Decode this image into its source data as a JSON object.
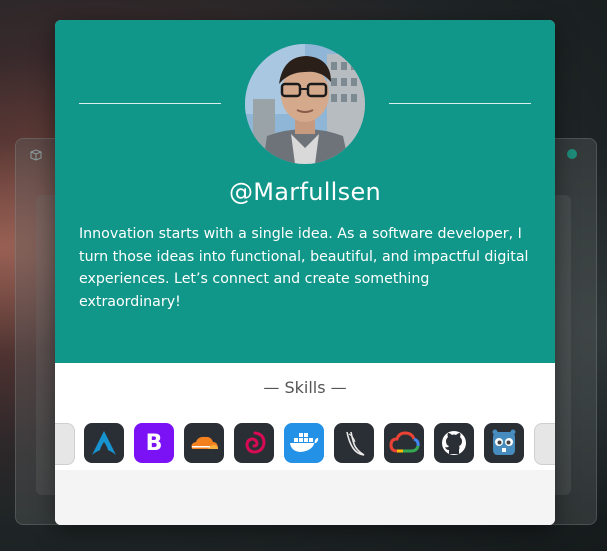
{
  "profile": {
    "username": "@Marfullsen",
    "bio": "Innovation starts with a single idea. As a software developer, I turn those ideas into functional, beautiful, and impactful digital experiences. Let’s connect and create something extraordinary!"
  },
  "skills": {
    "title": "— Skills —",
    "items": [
      {
        "name": "partial-icon-left"
      },
      {
        "name": "arch-linux-icon"
      },
      {
        "name": "bootstrap-icon",
        "glyph": "B"
      },
      {
        "name": "cloudflare-icon"
      },
      {
        "name": "debian-icon"
      },
      {
        "name": "docker-icon"
      },
      {
        "name": "flask-icon"
      },
      {
        "name": "google-cloud-icon"
      },
      {
        "name": "github-icon"
      },
      {
        "name": "godot-icon"
      },
      {
        "name": "partial-icon-right"
      }
    ]
  },
  "colors": {
    "card_accent": "#11968a",
    "bootstrap": "#7b12f5",
    "docker": "#2391e6"
  }
}
